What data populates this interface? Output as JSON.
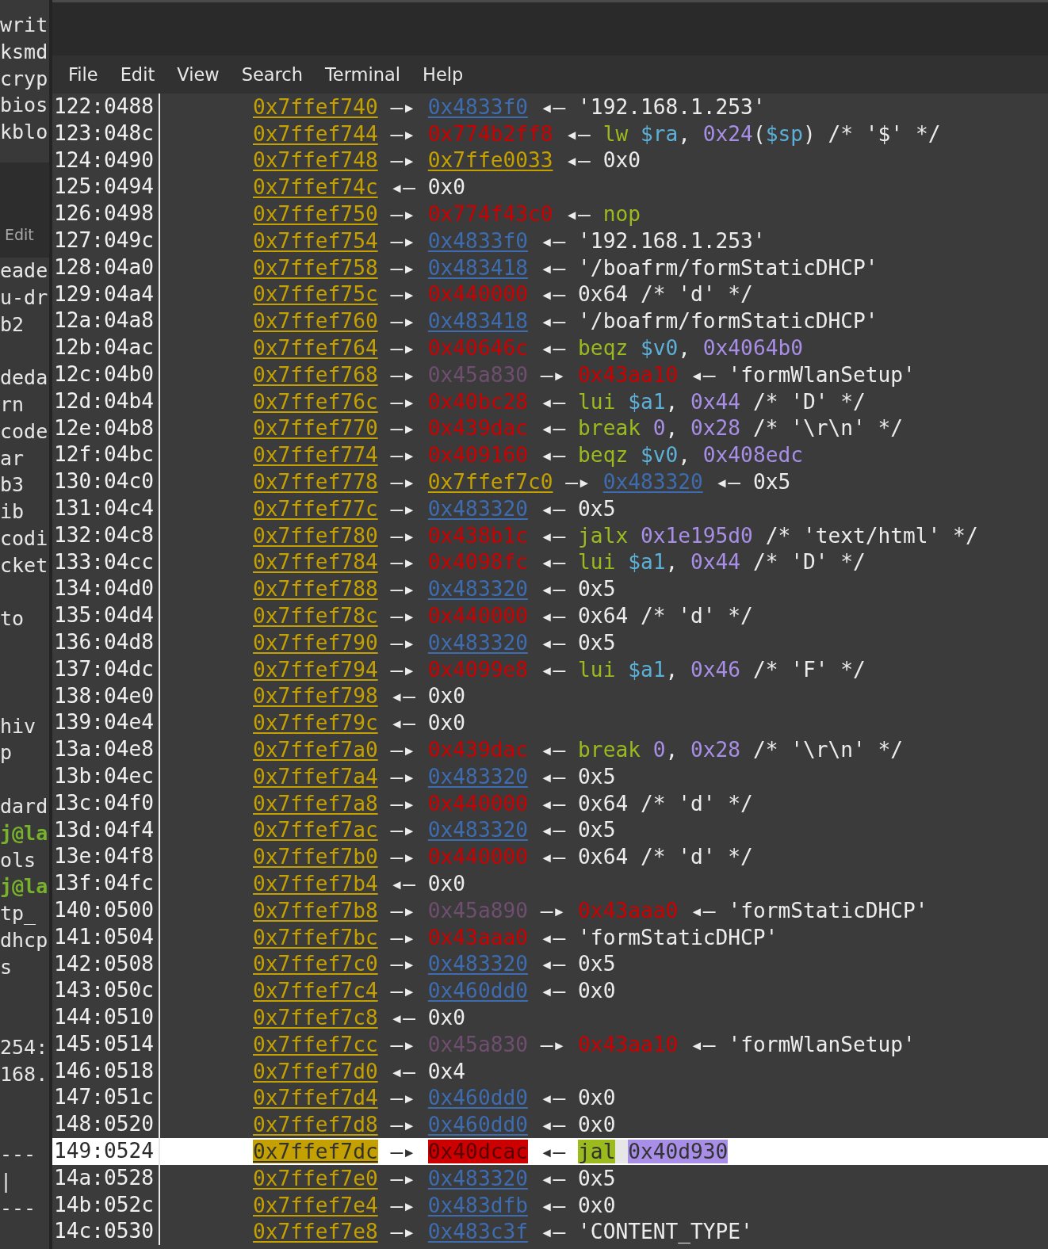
{
  "background_window": {
    "upper_lines": [
      "writ",
      "ksmd",
      "cryp",
      "bios",
      "kblo"
    ],
    "menu_label": "Edit",
    "lower_blocks": [
      [
        {
          "kind": "plain",
          "text": "eade"
        },
        {
          "kind": "plain",
          "text": "u-dr"
        },
        {
          "kind": "plain",
          "text": "b2"
        }
      ],
      [
        {
          "kind": "plain",
          "text": "deda"
        },
        {
          "kind": "plain",
          "text": "rn"
        },
        {
          "kind": "plain",
          "text": "code"
        },
        {
          "kind": "plain",
          "text": "ar"
        },
        {
          "kind": "plain",
          "text": "b3"
        },
        {
          "kind": "plain",
          "text": "ib"
        },
        {
          "kind": "plain",
          "text": "codi"
        },
        {
          "kind": "plain",
          "text": "cket"
        }
      ],
      [
        {
          "kind": "plain",
          "text": "to"
        }
      ],
      [
        {
          "kind": "plain",
          "text": "hiv"
        },
        {
          "kind": "plain",
          "text": "p"
        }
      ],
      [
        {
          "kind": "plain",
          "text": "dard"
        },
        {
          "kind": "prompt",
          "text": "j@la"
        },
        {
          "kind": "plain",
          "text": "ols"
        },
        {
          "kind": "prompt",
          "text": "j@la"
        },
        {
          "kind": "plain",
          "text": "tp_"
        },
        {
          "kind": "plain",
          "text": "dhcp"
        },
        {
          "kind": "plain",
          "text": "s"
        }
      ],
      [
        {
          "kind": "plain",
          "text": "254:"
        },
        {
          "kind": "plain",
          "text": "168."
        }
      ],
      [
        {
          "kind": "plain",
          "text": "---"
        },
        {
          "kind": "plain",
          "text": "|"
        },
        {
          "kind": "plain",
          "text": "---"
        }
      ]
    ]
  },
  "menu": [
    "File",
    "Edit",
    "View",
    "Search",
    "Terminal",
    "Help"
  ],
  "rows": [
    {
      "offset": "122:0488",
      "selected": false,
      "chain": [
        {
          "kind": "stack",
          "text": "0x7ffef740"
        },
        {
          "kind": "arrow",
          "text": "—▸"
        },
        {
          "kind": "heap",
          "text": "0x4833f0"
        },
        {
          "kind": "arrow",
          "text": "◂—"
        },
        {
          "kind": "value",
          "text": "'192.168.1.253'"
        }
      ]
    },
    {
      "offset": "123:048c",
      "selected": false,
      "chain": [
        {
          "kind": "stack",
          "text": "0x7ffef744"
        },
        {
          "kind": "arrow",
          "text": "—▸"
        },
        {
          "kind": "code",
          "text": "0x774b2ff8"
        },
        {
          "kind": "arrow",
          "text": "◂—"
        },
        {
          "kind": "insn",
          "tokens": [
            {
              "kind": "mnemonic",
              "text": "lw"
            },
            {
              "kind": "register",
              "text": "$ra"
            },
            {
              "kind": "text",
              "text": ", "
            },
            {
              "kind": "number",
              "text": "0x24"
            },
            {
              "kind": "text",
              "text": "("
            },
            {
              "kind": "register",
              "text": "$sp"
            },
            {
              "kind": "text",
              "text": ") /* '$' */"
            }
          ]
        }
      ]
    },
    {
      "offset": "124:0490",
      "selected": false,
      "chain": [
        {
          "kind": "stack",
          "text": "0x7ffef748"
        },
        {
          "kind": "arrow",
          "text": "—▸"
        },
        {
          "kind": "stack",
          "text": "0x7ffe0033"
        },
        {
          "kind": "arrow",
          "text": "◂—"
        },
        {
          "kind": "value",
          "text": "0x0"
        }
      ]
    },
    {
      "offset": "125:0494",
      "selected": false,
      "chain": [
        {
          "kind": "stack",
          "text": "0x7ffef74c"
        },
        {
          "kind": "arrow",
          "text": "◂—"
        },
        {
          "kind": "value",
          "text": "0x0"
        }
      ]
    },
    {
      "offset": "126:0498",
      "selected": false,
      "chain": [
        {
          "kind": "stack",
          "text": "0x7ffef750"
        },
        {
          "kind": "arrow",
          "text": "—▸"
        },
        {
          "kind": "code",
          "text": "0x774f43c0"
        },
        {
          "kind": "arrow",
          "text": "◂—"
        },
        {
          "kind": "insn",
          "tokens": [
            {
              "kind": "mnemonic",
              "text": "nop"
            }
          ]
        }
      ]
    },
    {
      "offset": "127:049c",
      "selected": false,
      "chain": [
        {
          "kind": "stack",
          "text": "0x7ffef754"
        },
        {
          "kind": "arrow",
          "text": "—▸"
        },
        {
          "kind": "heap",
          "text": "0x4833f0"
        },
        {
          "kind": "arrow",
          "text": "◂—"
        },
        {
          "kind": "value",
          "text": "'192.168.1.253'"
        }
      ]
    },
    {
      "offset": "128:04a0",
      "selected": false,
      "chain": [
        {
          "kind": "stack",
          "text": "0x7ffef758"
        },
        {
          "kind": "arrow",
          "text": "—▸"
        },
        {
          "kind": "heap",
          "text": "0x483418"
        },
        {
          "kind": "arrow",
          "text": "◂—"
        },
        {
          "kind": "value",
          "text": "'/boafrm/formStaticDHCP'"
        }
      ]
    },
    {
      "offset": "129:04a4",
      "selected": false,
      "chain": [
        {
          "kind": "stack",
          "text": "0x7ffef75c"
        },
        {
          "kind": "arrow",
          "text": "—▸"
        },
        {
          "kind": "code",
          "text": "0x440000"
        },
        {
          "kind": "arrow",
          "text": "◂—"
        },
        {
          "kind": "value",
          "text": "0x64 /* 'd' */"
        }
      ]
    },
    {
      "offset": "12a:04a8",
      "selected": false,
      "chain": [
        {
          "kind": "stack",
          "text": "0x7ffef760"
        },
        {
          "kind": "arrow",
          "text": "—▸"
        },
        {
          "kind": "heap",
          "text": "0x483418"
        },
        {
          "kind": "arrow",
          "text": "◂—"
        },
        {
          "kind": "value",
          "text": "'/boafrm/formStaticDHCP'"
        }
      ]
    },
    {
      "offset": "12b:04ac",
      "selected": false,
      "chain": [
        {
          "kind": "stack",
          "text": "0x7ffef764"
        },
        {
          "kind": "arrow",
          "text": "—▸"
        },
        {
          "kind": "code",
          "text": "0x40646c"
        },
        {
          "kind": "arrow",
          "text": "◂—"
        },
        {
          "kind": "insn",
          "tokens": [
            {
              "kind": "mnemonic",
              "text": "beqz"
            },
            {
              "kind": "register",
              "text": "$v0"
            },
            {
              "kind": "text",
              "text": ", "
            },
            {
              "kind": "number",
              "text": "0x4064b0"
            }
          ]
        }
      ]
    },
    {
      "offset": "12c:04b0",
      "selected": false,
      "chain": [
        {
          "kind": "stack",
          "text": "0x7ffef768"
        },
        {
          "kind": "arrow",
          "text": "—▸"
        },
        {
          "kind": "data",
          "text": "0x45a830"
        },
        {
          "kind": "arrow",
          "text": "—▸"
        },
        {
          "kind": "code",
          "text": "0x43aa10"
        },
        {
          "kind": "arrow",
          "text": "◂—"
        },
        {
          "kind": "value",
          "text": "'formWlanSetup'"
        }
      ]
    },
    {
      "offset": "12d:04b4",
      "selected": false,
      "chain": [
        {
          "kind": "stack",
          "text": "0x7ffef76c"
        },
        {
          "kind": "arrow",
          "text": "—▸"
        },
        {
          "kind": "code",
          "text": "0x40bc28"
        },
        {
          "kind": "arrow",
          "text": "◂—"
        },
        {
          "kind": "insn",
          "tokens": [
            {
              "kind": "mnemonic",
              "text": "lui"
            },
            {
              "kind": "register",
              "text": "$a1"
            },
            {
              "kind": "text",
              "text": ", "
            },
            {
              "kind": "number",
              "text": "0x44"
            },
            {
              "kind": "text",
              "text": " /* 'D' */"
            }
          ]
        }
      ]
    },
    {
      "offset": "12e:04b8",
      "selected": false,
      "chain": [
        {
          "kind": "stack",
          "text": "0x7ffef770"
        },
        {
          "kind": "arrow",
          "text": "—▸"
        },
        {
          "kind": "code",
          "text": "0x439dac"
        },
        {
          "kind": "arrow",
          "text": "◂—"
        },
        {
          "kind": "insn",
          "tokens": [
            {
              "kind": "mnemonic",
              "text": "break"
            },
            {
              "kind": "number",
              "text": "0"
            },
            {
              "kind": "text",
              "text": ", "
            },
            {
              "kind": "number",
              "text": "0x28"
            },
            {
              "kind": "text",
              "text": " /* '\\r\\n' */"
            }
          ]
        }
      ]
    },
    {
      "offset": "12f:04bc",
      "selected": false,
      "chain": [
        {
          "kind": "stack",
          "text": "0x7ffef774"
        },
        {
          "kind": "arrow",
          "text": "—▸"
        },
        {
          "kind": "code",
          "text": "0x409160"
        },
        {
          "kind": "arrow",
          "text": "◂—"
        },
        {
          "kind": "insn",
          "tokens": [
            {
              "kind": "mnemonic",
              "text": "beqz"
            },
            {
              "kind": "register",
              "text": "$v0"
            },
            {
              "kind": "text",
              "text": ", "
            },
            {
              "kind": "number",
              "text": "0x408edc"
            }
          ]
        }
      ]
    },
    {
      "offset": "130:04c0",
      "selected": false,
      "chain": [
        {
          "kind": "stack",
          "text": "0x7ffef778"
        },
        {
          "kind": "arrow",
          "text": "—▸"
        },
        {
          "kind": "stack",
          "text": "0x7ffef7c0"
        },
        {
          "kind": "arrow",
          "text": "—▸"
        },
        {
          "kind": "heap",
          "text": "0x483320"
        },
        {
          "kind": "arrow",
          "text": "◂—"
        },
        {
          "kind": "value",
          "text": "0x5"
        }
      ]
    },
    {
      "offset": "131:04c4",
      "selected": false,
      "chain": [
        {
          "kind": "stack",
          "text": "0x7ffef77c"
        },
        {
          "kind": "arrow",
          "text": "—▸"
        },
        {
          "kind": "heap",
          "text": "0x483320"
        },
        {
          "kind": "arrow",
          "text": "◂—"
        },
        {
          "kind": "value",
          "text": "0x5"
        }
      ]
    },
    {
      "offset": "132:04c8",
      "selected": false,
      "chain": [
        {
          "kind": "stack",
          "text": "0x7ffef780"
        },
        {
          "kind": "arrow",
          "text": "—▸"
        },
        {
          "kind": "code",
          "text": "0x438b1c"
        },
        {
          "kind": "arrow",
          "text": "◂—"
        },
        {
          "kind": "insn",
          "tokens": [
            {
              "kind": "mnemonic",
              "text": "jalx"
            },
            {
              "kind": "number",
              "text": "0x1e195d0"
            },
            {
              "kind": "text",
              "text": " /* 'text/html' */"
            }
          ]
        }
      ]
    },
    {
      "offset": "133:04cc",
      "selected": false,
      "chain": [
        {
          "kind": "stack",
          "text": "0x7ffef784"
        },
        {
          "kind": "arrow",
          "text": "—▸"
        },
        {
          "kind": "code",
          "text": "0x4098fc"
        },
        {
          "kind": "arrow",
          "text": "◂—"
        },
        {
          "kind": "insn",
          "tokens": [
            {
              "kind": "mnemonic",
              "text": "lui"
            },
            {
              "kind": "register",
              "text": "$a1"
            },
            {
              "kind": "text",
              "text": ", "
            },
            {
              "kind": "number",
              "text": "0x44"
            },
            {
              "kind": "text",
              "text": " /* 'D' */"
            }
          ]
        }
      ]
    },
    {
      "offset": "134:04d0",
      "selected": false,
      "chain": [
        {
          "kind": "stack",
          "text": "0x7ffef788"
        },
        {
          "kind": "arrow",
          "text": "—▸"
        },
        {
          "kind": "heap",
          "text": "0x483320"
        },
        {
          "kind": "arrow",
          "text": "◂—"
        },
        {
          "kind": "value",
          "text": "0x5"
        }
      ]
    },
    {
      "offset": "135:04d4",
      "selected": false,
      "chain": [
        {
          "kind": "stack",
          "text": "0x7ffef78c"
        },
        {
          "kind": "arrow",
          "text": "—▸"
        },
        {
          "kind": "code",
          "text": "0x440000"
        },
        {
          "kind": "arrow",
          "text": "◂—"
        },
        {
          "kind": "value",
          "text": "0x64 /* 'd' */"
        }
      ]
    },
    {
      "offset": "136:04d8",
      "selected": false,
      "chain": [
        {
          "kind": "stack",
          "text": "0x7ffef790"
        },
        {
          "kind": "arrow",
          "text": "—▸"
        },
        {
          "kind": "heap",
          "text": "0x483320"
        },
        {
          "kind": "arrow",
          "text": "◂—"
        },
        {
          "kind": "value",
          "text": "0x5"
        }
      ]
    },
    {
      "offset": "137:04dc",
      "selected": false,
      "chain": [
        {
          "kind": "stack",
          "text": "0x7ffef794"
        },
        {
          "kind": "arrow",
          "text": "—▸"
        },
        {
          "kind": "code",
          "text": "0x4099e8"
        },
        {
          "kind": "arrow",
          "text": "◂—"
        },
        {
          "kind": "insn",
          "tokens": [
            {
              "kind": "mnemonic",
              "text": "lui"
            },
            {
              "kind": "register",
              "text": "$a1"
            },
            {
              "kind": "text",
              "text": ", "
            },
            {
              "kind": "number",
              "text": "0x46"
            },
            {
              "kind": "text",
              "text": " /* 'F' */"
            }
          ]
        }
      ]
    },
    {
      "offset": "138:04e0",
      "selected": false,
      "chain": [
        {
          "kind": "stack",
          "text": "0x7ffef798"
        },
        {
          "kind": "arrow",
          "text": "◂—"
        },
        {
          "kind": "value",
          "text": "0x0"
        }
      ]
    },
    {
      "offset": "139:04e4",
      "selected": false,
      "chain": [
        {
          "kind": "stack",
          "text": "0x7ffef79c"
        },
        {
          "kind": "arrow",
          "text": "◂—"
        },
        {
          "kind": "value",
          "text": "0x0"
        }
      ]
    },
    {
      "offset": "13a:04e8",
      "selected": false,
      "chain": [
        {
          "kind": "stack",
          "text": "0x7ffef7a0"
        },
        {
          "kind": "arrow",
          "text": "—▸"
        },
        {
          "kind": "code",
          "text": "0x439dac"
        },
        {
          "kind": "arrow",
          "text": "◂—"
        },
        {
          "kind": "insn",
          "tokens": [
            {
              "kind": "mnemonic",
              "text": "break"
            },
            {
              "kind": "number",
              "text": "0"
            },
            {
              "kind": "text",
              "text": ", "
            },
            {
              "kind": "number",
              "text": "0x28"
            },
            {
              "kind": "text",
              "text": " /* '\\r\\n' */"
            }
          ]
        }
      ]
    },
    {
      "offset": "13b:04ec",
      "selected": false,
      "chain": [
        {
          "kind": "stack",
          "text": "0x7ffef7a4"
        },
        {
          "kind": "arrow",
          "text": "—▸"
        },
        {
          "kind": "heap",
          "text": "0x483320"
        },
        {
          "kind": "arrow",
          "text": "◂—"
        },
        {
          "kind": "value",
          "text": "0x5"
        }
      ]
    },
    {
      "offset": "13c:04f0",
      "selected": false,
      "chain": [
        {
          "kind": "stack",
          "text": "0x7ffef7a8"
        },
        {
          "kind": "arrow",
          "text": "—▸"
        },
        {
          "kind": "code",
          "text": "0x440000"
        },
        {
          "kind": "arrow",
          "text": "◂—"
        },
        {
          "kind": "value",
          "text": "0x64 /* 'd' */"
        }
      ]
    },
    {
      "offset": "13d:04f4",
      "selected": false,
      "chain": [
        {
          "kind": "stack",
          "text": "0x7ffef7ac"
        },
        {
          "kind": "arrow",
          "text": "—▸"
        },
        {
          "kind": "heap",
          "text": "0x483320"
        },
        {
          "kind": "arrow",
          "text": "◂—"
        },
        {
          "kind": "value",
          "text": "0x5"
        }
      ]
    },
    {
      "offset": "13e:04f8",
      "selected": false,
      "chain": [
        {
          "kind": "stack",
          "text": "0x7ffef7b0"
        },
        {
          "kind": "arrow",
          "text": "—▸"
        },
        {
          "kind": "code",
          "text": "0x440000"
        },
        {
          "kind": "arrow",
          "text": "◂—"
        },
        {
          "kind": "value",
          "text": "0x64 /* 'd' */"
        }
      ]
    },
    {
      "offset": "13f:04fc",
      "selected": false,
      "chain": [
        {
          "kind": "stack",
          "text": "0x7ffef7b4"
        },
        {
          "kind": "arrow",
          "text": "◂—"
        },
        {
          "kind": "value",
          "text": "0x0"
        }
      ]
    },
    {
      "offset": "140:0500",
      "selected": false,
      "chain": [
        {
          "kind": "stack",
          "text": "0x7ffef7b8"
        },
        {
          "kind": "arrow",
          "text": "—▸"
        },
        {
          "kind": "data",
          "text": "0x45a890"
        },
        {
          "kind": "arrow",
          "text": "—▸"
        },
        {
          "kind": "code",
          "text": "0x43aaa0"
        },
        {
          "kind": "arrow",
          "text": "◂—"
        },
        {
          "kind": "value",
          "text": "'formStaticDHCP'"
        }
      ]
    },
    {
      "offset": "141:0504",
      "selected": false,
      "chain": [
        {
          "kind": "stack",
          "text": "0x7ffef7bc"
        },
        {
          "kind": "arrow",
          "text": "—▸"
        },
        {
          "kind": "code",
          "text": "0x43aaa0"
        },
        {
          "kind": "arrow",
          "text": "◂—"
        },
        {
          "kind": "value",
          "text": "'formStaticDHCP'"
        }
      ]
    },
    {
      "offset": "142:0508",
      "selected": false,
      "chain": [
        {
          "kind": "stack",
          "text": "0x7ffef7c0"
        },
        {
          "kind": "arrow",
          "text": "—▸"
        },
        {
          "kind": "heap",
          "text": "0x483320"
        },
        {
          "kind": "arrow",
          "text": "◂—"
        },
        {
          "kind": "value",
          "text": "0x5"
        }
      ]
    },
    {
      "offset": "143:050c",
      "selected": false,
      "chain": [
        {
          "kind": "stack",
          "text": "0x7ffef7c4"
        },
        {
          "kind": "arrow",
          "text": "—▸"
        },
        {
          "kind": "heap",
          "text": "0x460dd0"
        },
        {
          "kind": "arrow",
          "text": "◂—"
        },
        {
          "kind": "value",
          "text": "0x0"
        }
      ]
    },
    {
      "offset": "144:0510",
      "selected": false,
      "chain": [
        {
          "kind": "stack",
          "text": "0x7ffef7c8"
        },
        {
          "kind": "arrow",
          "text": "◂—"
        },
        {
          "kind": "value",
          "text": "0x0"
        }
      ]
    },
    {
      "offset": "145:0514",
      "selected": false,
      "chain": [
        {
          "kind": "stack",
          "text": "0x7ffef7cc"
        },
        {
          "kind": "arrow",
          "text": "—▸"
        },
        {
          "kind": "data",
          "text": "0x45a830"
        },
        {
          "kind": "arrow",
          "text": "—▸"
        },
        {
          "kind": "code",
          "text": "0x43aa10"
        },
        {
          "kind": "arrow",
          "text": "◂—"
        },
        {
          "kind": "value",
          "text": "'formWlanSetup'"
        }
      ]
    },
    {
      "offset": "146:0518",
      "selected": false,
      "chain": [
        {
          "kind": "stack",
          "text": "0x7ffef7d0"
        },
        {
          "kind": "arrow",
          "text": "◂—"
        },
        {
          "kind": "value",
          "text": "0x4"
        }
      ]
    },
    {
      "offset": "147:051c",
      "selected": false,
      "chain": [
        {
          "kind": "stack",
          "text": "0x7ffef7d4"
        },
        {
          "kind": "arrow",
          "text": "—▸"
        },
        {
          "kind": "heap",
          "text": "0x460dd0"
        },
        {
          "kind": "arrow",
          "text": "◂—"
        },
        {
          "kind": "value",
          "text": "0x0"
        }
      ]
    },
    {
      "offset": "148:0520",
      "selected": false,
      "chain": [
        {
          "kind": "stack",
          "text": "0x7ffef7d8"
        },
        {
          "kind": "arrow",
          "text": "—▸"
        },
        {
          "kind": "heap",
          "text": "0x460dd0"
        },
        {
          "kind": "arrow",
          "text": "◂—"
        },
        {
          "kind": "value",
          "text": "0x0"
        }
      ]
    },
    {
      "offset": "149:0524",
      "selected": true,
      "chain": [
        {
          "kind": "stack",
          "text": "0x7ffef7dc"
        },
        {
          "kind": "arrow",
          "text": "—▸"
        },
        {
          "kind": "code",
          "text": "0x40dcac"
        },
        {
          "kind": "arrow",
          "text": "◂—"
        },
        {
          "kind": "insn",
          "tokens": [
            {
              "kind": "mnemonic",
              "text": "jal"
            },
            {
              "kind": "number",
              "text": "0x40d930"
            }
          ]
        }
      ]
    },
    {
      "offset": "14a:0528",
      "selected": false,
      "chain": [
        {
          "kind": "stack",
          "text": "0x7ffef7e0"
        },
        {
          "kind": "arrow",
          "text": "—▸"
        },
        {
          "kind": "heap",
          "text": "0x483320"
        },
        {
          "kind": "arrow",
          "text": "◂—"
        },
        {
          "kind": "value",
          "text": "0x5"
        }
      ]
    },
    {
      "offset": "14b:052c",
      "selected": false,
      "chain": [
        {
          "kind": "stack",
          "text": "0x7ffef7e4"
        },
        {
          "kind": "arrow",
          "text": "—▸"
        },
        {
          "kind": "heap",
          "text": "0x483dfb"
        },
        {
          "kind": "arrow",
          "text": "◂—"
        },
        {
          "kind": "value",
          "text": "0x0"
        }
      ]
    },
    {
      "offset": "14c:0530",
      "selected": false,
      "chain": [
        {
          "kind": "stack",
          "text": "0x7ffef7e8"
        },
        {
          "kind": "arrow",
          "text": "—▸"
        },
        {
          "kind": "heap",
          "text": "0x483c3f"
        },
        {
          "kind": "arrow",
          "text": "◂—"
        },
        {
          "kind": "value",
          "text": "'CONTENT_TYPE'"
        }
      ]
    }
  ]
}
